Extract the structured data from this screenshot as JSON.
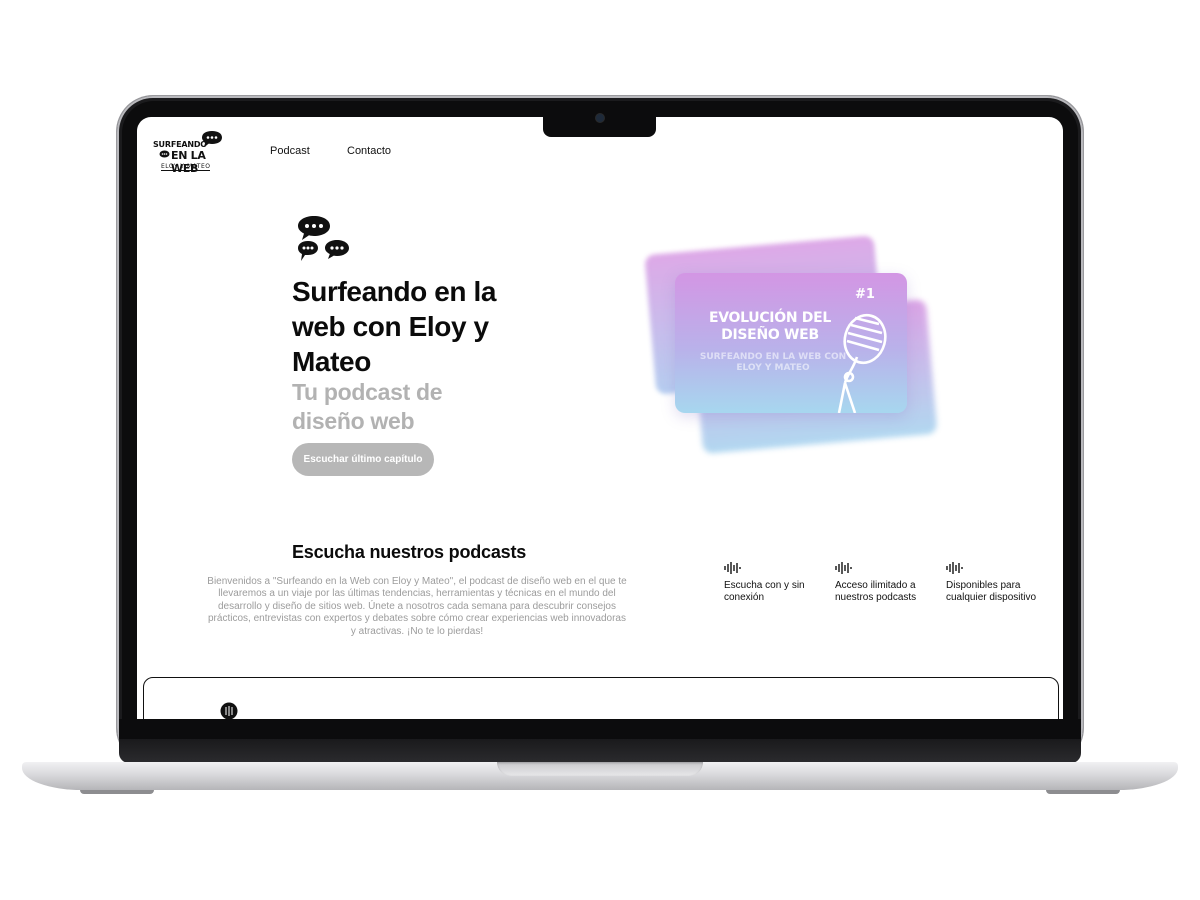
{
  "header": {
    "logo": {
      "line1": "SURFEANDO",
      "line2": "EN LA WEB",
      "line3": "ELOY Y MATEO"
    },
    "nav": [
      "Podcast",
      "Contacto"
    ]
  },
  "hero": {
    "title": "Surfeando en la web con Eloy y Mateo",
    "subtitle": "Tu podcast de diseño web",
    "cta_label": "Escuchar último capítulo",
    "cover": {
      "number": "#1",
      "title": "EVOLUCIÓN DEL DISEÑO WEB",
      "subtitle": "SURFEANDO EN LA WEB CON ELOY Y MATEO"
    }
  },
  "section": {
    "title": "Escucha nuestros podcasts",
    "description": "Bienvenidos a \"Surfeando en la Web con Eloy y Mateo\", el podcast de diseño web en el que te llevaremos a un viaje por las últimas tendencias, herramientas y técnicas en el mundo del desarrollo y diseño de sitios web. Únete a nosotros cada semana para descubrir consejos prácticos, entrevistas con expertos y debates sobre cómo crear experiencias web innovadoras y atractivas. ¡No te lo pierdas!",
    "features": [
      {
        "icon": "waveform-icon",
        "text": "Escucha con y sin conexión"
      },
      {
        "icon": "waveform-icon",
        "text": "Acceso ilimitado a nuestros podcasts"
      },
      {
        "icon": "waveform-icon",
        "text": "Disponibles para cualquier dispositivo"
      }
    ]
  },
  "colors": {
    "text": "#0b0b0b",
    "muted": "#b2b2b2",
    "button": "#b7b7b7",
    "card_gradient_top": "#d396e4",
    "card_gradient_bottom": "#a7d7ef"
  }
}
